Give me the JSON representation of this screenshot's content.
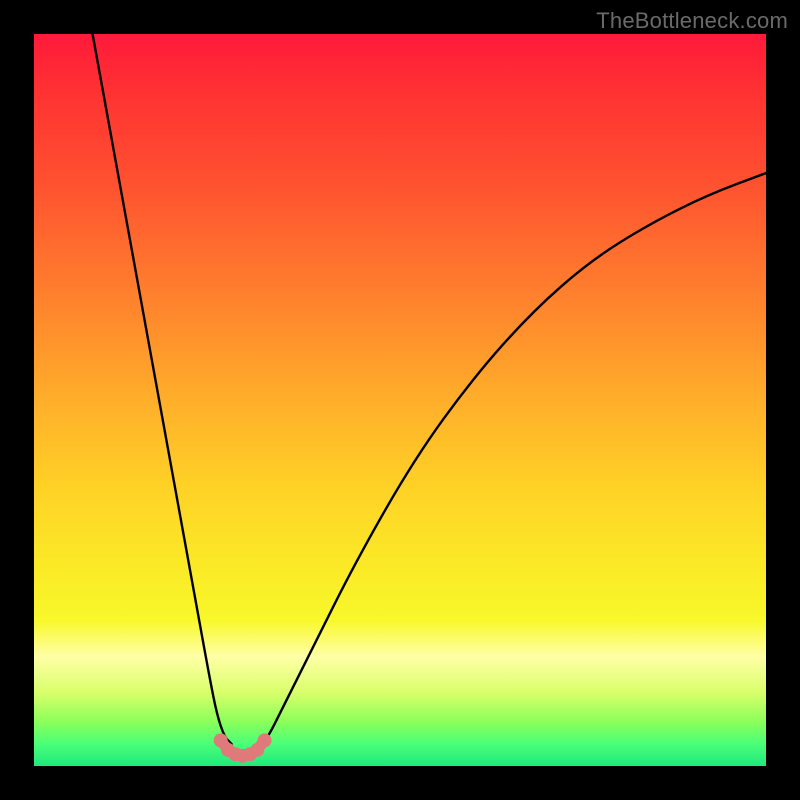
{
  "attribution": "TheBottleneck.com",
  "colors": {
    "frame": "#000000",
    "grad_top": "#ff1a3a",
    "grad_bottom": "#20e87e",
    "curve_stroke": "#000000",
    "marker_fill": "#e07a7a",
    "marker_stroke": "#c85a5a"
  },
  "chart_data": {
    "type": "line",
    "title": "",
    "xlabel": "",
    "ylabel": "",
    "xlim": [
      0,
      100
    ],
    "ylim": [
      0,
      100
    ],
    "annotations": [
      "TheBottleneck.com"
    ],
    "series": [
      {
        "name": "left-branch",
        "x": [
          8,
          10,
          12,
          14,
          16,
          18,
          20,
          22,
          24,
          25,
          26,
          27
        ],
        "y": [
          100,
          89,
          78,
          67,
          56,
          45,
          34,
          23,
          12,
          7,
          4,
          3
        ]
      },
      {
        "name": "right-branch",
        "x": [
          31,
          32,
          34,
          38,
          44,
          52,
          60,
          68,
          76,
          84,
          92,
          100
        ],
        "y": [
          3,
          4,
          8,
          16,
          28,
          42,
          53,
          62,
          69,
          74,
          78,
          81
        ]
      },
      {
        "name": "bottom-arc-markers",
        "x": [
          25.5,
          26.5,
          27.5,
          28.5,
          29.5,
          30.5,
          31.5
        ],
        "y": [
          3.5,
          2.2,
          1.6,
          1.4,
          1.6,
          2.2,
          3.5
        ]
      }
    ]
  }
}
